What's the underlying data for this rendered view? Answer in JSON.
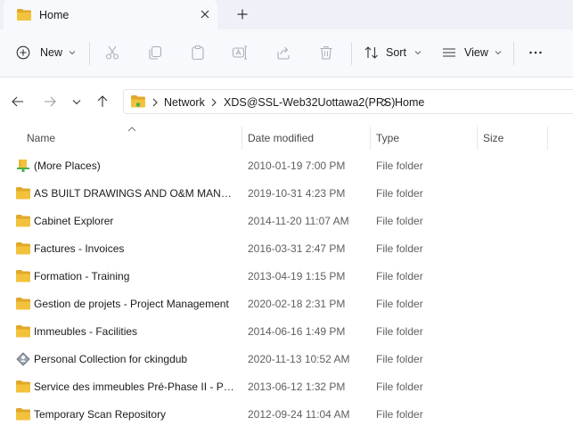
{
  "tab": {
    "title": "Home"
  },
  "toolbar": {
    "new_label": "New",
    "sort_label": "Sort",
    "view_label": "View"
  },
  "breadcrumb": [
    "Network",
    "XDS@SSL-Web32Uottawa2(PRS)",
    "Home"
  ],
  "columns": {
    "name": "Name",
    "date_modified": "Date modified",
    "type": "Type",
    "size": "Size"
  },
  "rows": [
    {
      "name": "(More Places)",
      "date": "2010-01-19 7:00 PM",
      "type": "File folder",
      "icon": "network-places-icon"
    },
    {
      "name": "AS BUILT DRAWINGS AND O&M MANUALS",
      "date": "2019-10-31 4:23 PM",
      "type": "File folder",
      "icon": "folder-icon"
    },
    {
      "name": "Cabinet Explorer",
      "date": "2014-11-20 11:07 AM",
      "type": "File folder",
      "icon": "folder-icon"
    },
    {
      "name": "Factures - Invoices",
      "date": "2016-03-31 2:47 PM",
      "type": "File folder",
      "icon": "folder-icon"
    },
    {
      "name": "Formation - Training",
      "date": "2013-04-19 1:15 PM",
      "type": "File folder",
      "icon": "folder-icon"
    },
    {
      "name": "Gestion de projets - Project Management",
      "date": "2020-02-18 2:31 PM",
      "type": "File folder",
      "icon": "folder-icon"
    },
    {
      "name": "Immeubles - Facilities",
      "date": "2014-06-16 1:49 PM",
      "type": "File folder",
      "icon": "folder-icon"
    },
    {
      "name": "Personal Collection for ckingdub",
      "date": "2020-11-13 10:52 AM",
      "type": "File folder",
      "icon": "personal-collection-icon"
    },
    {
      "name": "Service des immeubles Pré-Phase II - Physical Resources Service",
      "date": "2013-06-12 1:32 PM",
      "type": "File folder",
      "icon": "folder-icon"
    },
    {
      "name": "Temporary Scan Repository",
      "date": "2012-09-24 11:04 AM",
      "type": "File folder",
      "icon": "folder-icon"
    }
  ],
  "colors": {
    "folder": "#f3c23c",
    "folder_dark": "#e1a82a",
    "tabstrip": "#eef1f7",
    "toolbar": "#f7f9fc"
  }
}
